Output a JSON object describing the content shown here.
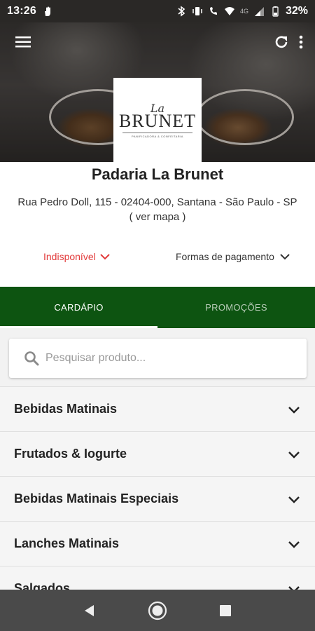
{
  "status_bar": {
    "time": "13:26",
    "network": "4G",
    "battery": "32%",
    "icons": [
      "hand-icon",
      "bluetooth-icon",
      "vibrate-icon",
      "wifi-calling-icon",
      "wifi-icon",
      "signal-icon",
      "battery-icon"
    ]
  },
  "toolbar": {
    "icons": [
      "menu-icon",
      "refresh-icon",
      "more-vert-icon"
    ]
  },
  "logo": {
    "script": "La",
    "name": "BRUNET",
    "subtitle": "PANIFICADORA & CONFEITARIA"
  },
  "store": {
    "name": "Padaria La Brunet",
    "address": "Rua Pedro Doll, 115 - 02404-000, Santana - São Paulo - SP",
    "map_link": "( ver mapa )",
    "availability": "Indisponível",
    "payment_label": "Formas de pagamento"
  },
  "tabs": [
    {
      "label": "CARDÁPIO",
      "active": true
    },
    {
      "label": "PROMOÇÕES",
      "active": false
    }
  ],
  "search": {
    "placeholder": "Pesquisar produto...",
    "value": ""
  },
  "categories": [
    {
      "label": "Bebidas Matinais"
    },
    {
      "label": "Frutados & Iogurte"
    },
    {
      "label": "Bebidas Matinais Especiais"
    },
    {
      "label": "Lanches Matinais"
    },
    {
      "label": "Salgados"
    }
  ],
  "nav": {
    "icons": [
      "back-icon",
      "home-icon",
      "recents-icon"
    ]
  },
  "colors": {
    "primary_green": "#0d5411",
    "unavailable_red": "#e23b3b"
  }
}
